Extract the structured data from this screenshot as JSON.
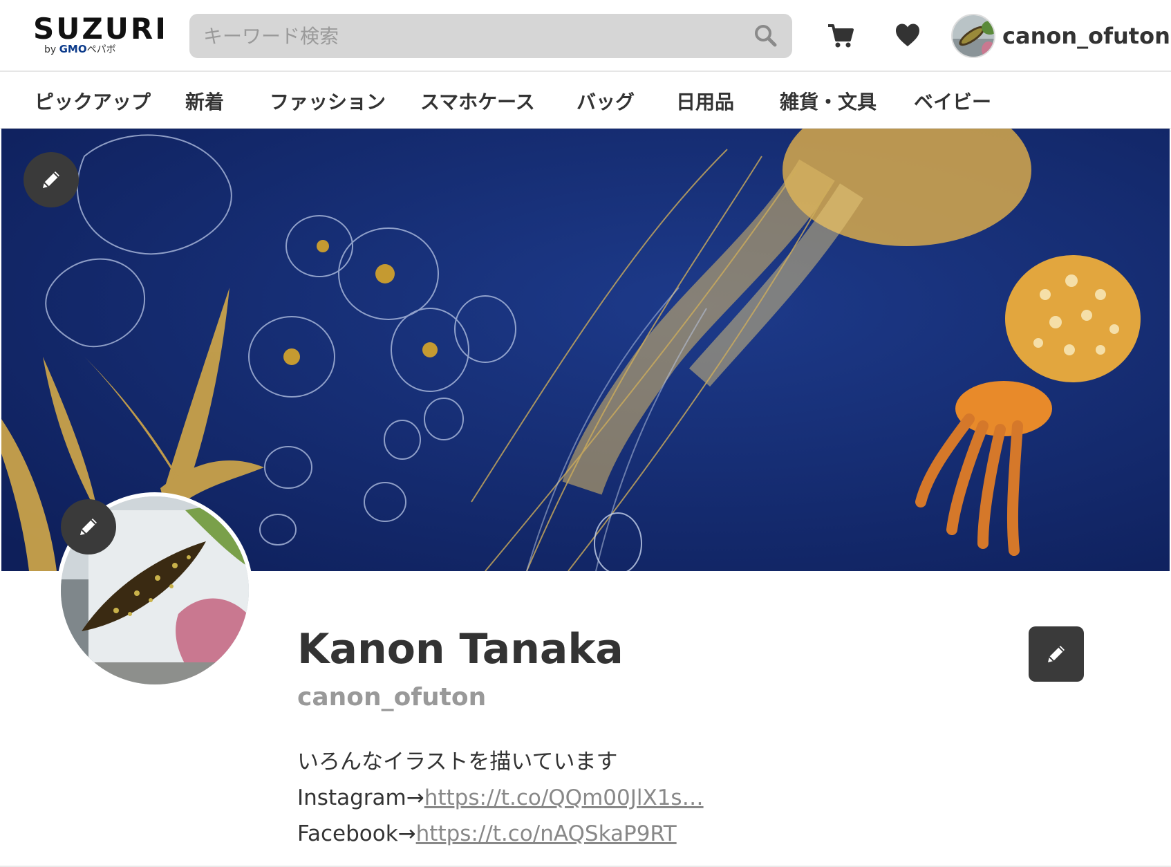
{
  "header": {
    "logo_main": "SUZURI",
    "logo_by": "by",
    "logo_gmo": "GMO",
    "logo_pepabo": "ペパボ",
    "search_placeholder": "キーワード検索",
    "username": "canon_ofuton"
  },
  "nav": {
    "items": [
      "ピックアップ",
      "新着",
      "ファッション",
      "スマホケース",
      "バッグ",
      "日用品",
      "雑貨・文具",
      "ベイビー"
    ]
  },
  "profile": {
    "display_name": "Kanon Tanaka",
    "handle": "canon_ofuton",
    "bio_line1": "いろんなイラストを描いています",
    "instagram_prefix": "Instagram→",
    "instagram_link": "https://t.co/QQm00JlX1s…",
    "facebook_prefix": "Facebook→",
    "facebook_link": "https://t.co/nAQSkaP9RT"
  },
  "colors": {
    "banner_bg": "#13286a",
    "edit_button": "#3a3a3a",
    "search_bg": "#d6d6d6",
    "handle_gray": "#999999"
  },
  "icons": [
    "search-icon",
    "cart-icon",
    "heart-icon",
    "pencil-icon"
  ]
}
